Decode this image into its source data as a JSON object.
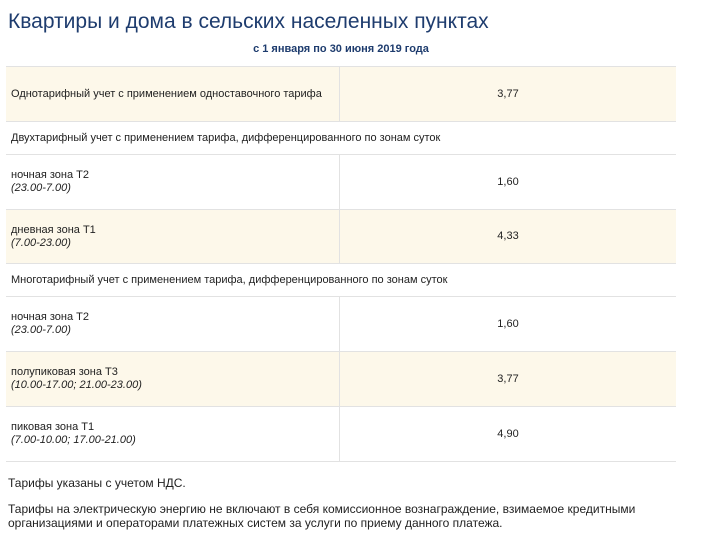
{
  "page": {
    "title": "Квартиры и дома в сельских населенных пунктах",
    "period": "с 1 января по 30 июня 2019 года"
  },
  "tariffs": {
    "single": {
      "label": "Однотарифный учет с применением одноставочного тарифа",
      "value": "3,77"
    },
    "two_zone": {
      "header": "Двухтарифный учет с применением тарифа, дифференцированного по зонам суток",
      "rows": [
        {
          "zone": "ночная зона Т2",
          "period": "(23.00-7.00)",
          "value": "1,60"
        },
        {
          "zone": "дневная зона Т1",
          "period": "(7.00-23.00)",
          "value": "4,33"
        }
      ]
    },
    "multi_zone": {
      "header": "Многотарифный учет с применением тарифа, дифференцированного по зонам суток",
      "rows": [
        {
          "zone": "ночная зона Т2",
          "period": "(23.00-7.00)",
          "value": "1,60"
        },
        {
          "zone": "полупиковая зона Т3",
          "period": "(10.00-17.00; 21.00-23.00)",
          "value": "3,77"
        },
        {
          "zone": "пиковая зона Т1",
          "period": "(7.00-10.00; 17.00-21.00)",
          "value": "4,90"
        }
      ]
    }
  },
  "notes": {
    "vat": "Тарифы указаны с учетом НДС.",
    "commission": "Тарифы на электрическую энергию не включают в себя комиссионное вознаграждение, взимаемое кредитными организациями и операторами платежных систем за услуги по приему данного платежа."
  },
  "colors": {
    "title": "#1e3c6e",
    "highlight_row": "#fdf8ea",
    "border": "#e2e2e2"
  }
}
